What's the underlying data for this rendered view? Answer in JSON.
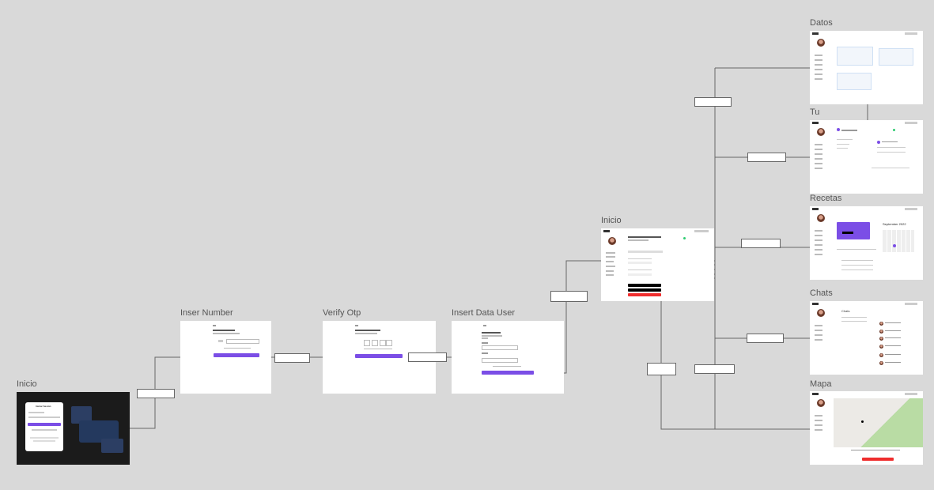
{
  "frames": {
    "inicio_login": {
      "label": "Inicio"
    },
    "inser_number": {
      "label": "Inser Number"
    },
    "verify_otp": {
      "label": "Verify Otp"
    },
    "insert_data_user": {
      "label": "Insert Data User"
    },
    "inicio_home": {
      "label": "Inicio"
    },
    "datos": {
      "label": "Datos"
    },
    "tu": {
      "label": "Tu"
    },
    "recetas": {
      "label": "Recetas"
    },
    "chats": {
      "label": "Chats"
    },
    "mapa": {
      "label": "Mapa"
    }
  },
  "login": {
    "title": "Iniciar Sesión"
  },
  "recetas": {
    "calendar_month": "September 2022"
  },
  "chats": {
    "title": "Chats"
  },
  "colors": {
    "canvas": "#d9d9d9",
    "primary": "#7b4ee6",
    "danger": "#ef2d2d",
    "connector": "#666666",
    "dark_frame": "#1b1b1b"
  }
}
